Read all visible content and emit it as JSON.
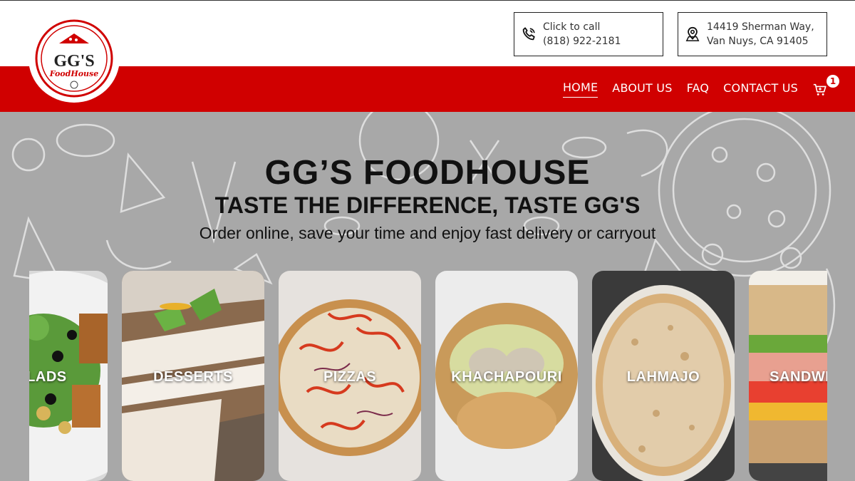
{
  "brand": {
    "logo_text": "GG'S",
    "logo_script": "FoodHouse",
    "logo_ring_text": "taste the difference, taste GG's",
    "color_primary": "#d00000"
  },
  "contact": {
    "phone_label": "Click to call",
    "phone_number": "(818) 922-2181",
    "address_line1": "14419 Sherman Way,",
    "address_line2": "Van Nuys, CA 91405",
    "phone_icon": "phone-icon",
    "address_icon": "map-pin-icon"
  },
  "nav": {
    "items": [
      {
        "label": "HOME",
        "active": true
      },
      {
        "label": "ABOUT US",
        "active": false
      },
      {
        "label": "FAQ",
        "active": false
      },
      {
        "label": "CONTACT US",
        "active": false
      }
    ],
    "cart_count": "1",
    "cart_icon": "cart-icon"
  },
  "hero": {
    "title": "GG’S FOODHOUSE",
    "subtitle": "TASTE THE DIFFERENCE, TASTE GG'S",
    "tagline": "Order online, save your time and enjoy fast delivery or carryout"
  },
  "categories": [
    {
      "label": "SALADS"
    },
    {
      "label": "DESSERTS"
    },
    {
      "label": "PIZZAS"
    },
    {
      "label": "KHACHAPOURI"
    },
    {
      "label": "LAHMAJO"
    },
    {
      "label": "SANDWICHES"
    }
  ]
}
